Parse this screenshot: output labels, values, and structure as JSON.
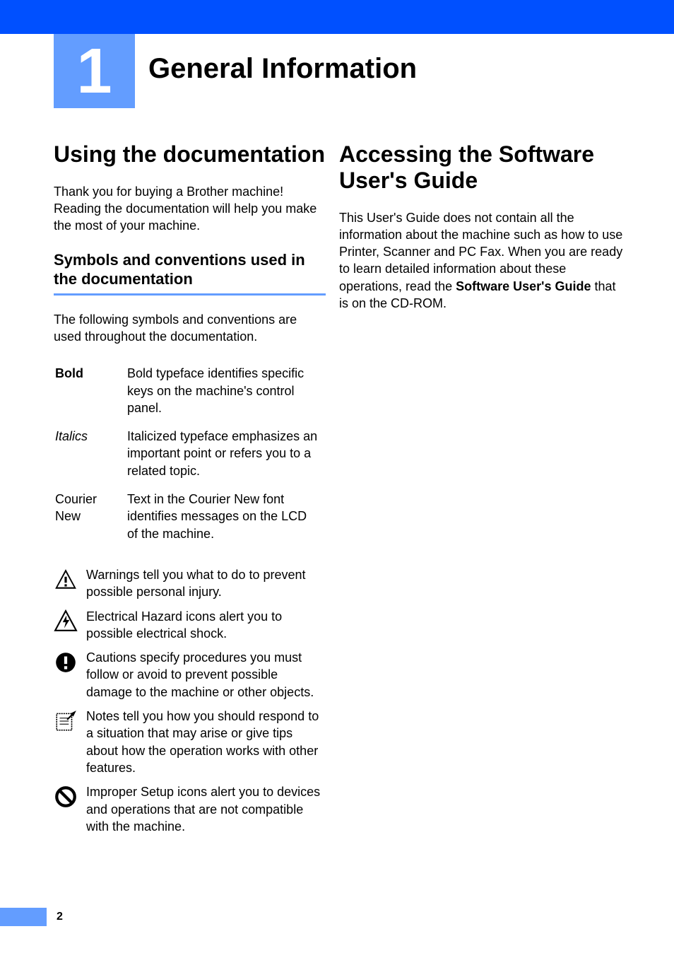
{
  "chapter": {
    "number": "1",
    "title": "General Information"
  },
  "left": {
    "heading": "Using the documentation",
    "para1": "Thank you for buying a Brother machine! Reading the documentation will help you make the most of your machine.",
    "sub_heading": "Symbols and conventions used in the documentation",
    "para2": "The following symbols and conventions are used throughout the documentation.",
    "conventions": {
      "bold_term": "Bold",
      "bold_desc": "Bold typeface identifies specific keys on the machine's control panel.",
      "italics_term": "Italics",
      "italics_desc": "Italicized typeface emphasizes an important point or refers you to a related topic.",
      "courier_term": "Courier New",
      "courier_desc": "Text in the Courier New font identifies messages on the LCD of the machine."
    },
    "icons": {
      "warning": "Warnings tell you what to do to prevent possible personal injury.",
      "electrical": "Electrical Hazard icons alert you to possible electrical shock.",
      "caution": "Cautions specify procedures you must follow or avoid to prevent possible damage to the machine or other objects.",
      "note": "Notes tell you how you should respond to a situation that may arise or give tips about how the operation works with other features.",
      "improper": "Improper Setup icons alert you to devices and operations that are not compatible with the machine."
    }
  },
  "right": {
    "heading": "Accessing the Software User's Guide",
    "para_pre": "This User's Guide does not contain all the information about the machine such as how to use Printer, Scanner and PC Fax. When you are ready to learn detailed information about these operations, read the ",
    "para_bold": "Software User's Guide",
    "para_post": " that is on the CD-ROM."
  },
  "page_number": "2"
}
